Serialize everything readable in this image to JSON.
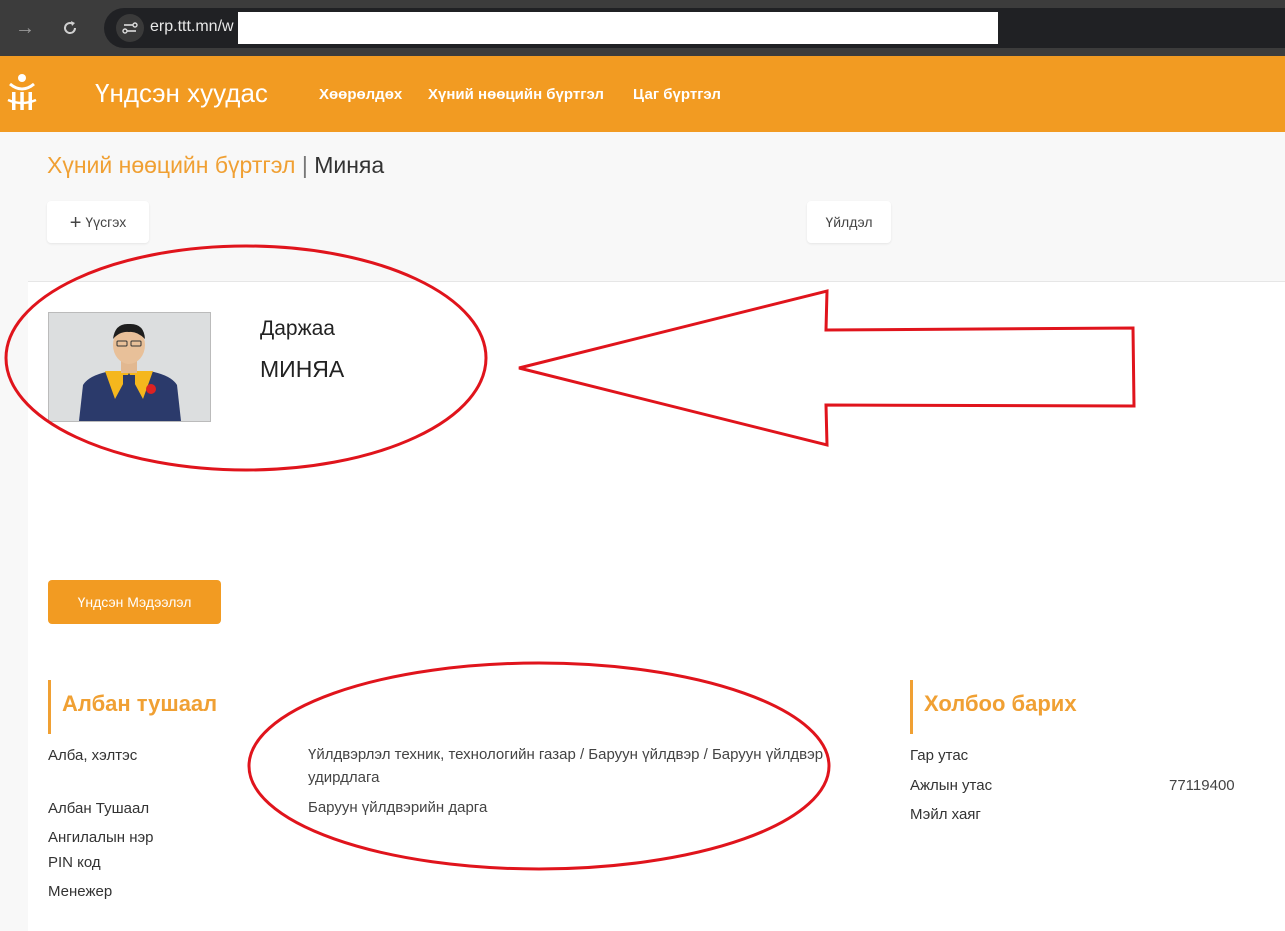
{
  "browser": {
    "url": "erp.ttt.mn/w"
  },
  "navbar": {
    "brand": "Үндсэн хуудас",
    "links": [
      "Хөөрөлдөх",
      "Хүний нөөцийн бүртгэл",
      "Цаг бүртгэл"
    ],
    "color": "#f29b22"
  },
  "page": {
    "breadcrumb_link": "Хүний нөөцийн бүртгэл",
    "separator": "|",
    "current": "Миняа",
    "create_button": "Үүсгэх",
    "action_button": "Үйлдэл"
  },
  "profile": {
    "first_name": "Даржаа",
    "last_name": "МИНЯА"
  },
  "tab": {
    "label": "Үндсэн Мэдээлэл"
  },
  "position_section": {
    "title": "Албан тушаал",
    "fields": [
      {
        "label": "Алба, хэлтэс",
        "value": "Үйлдвэрлэл техник, технологийн газар / Баруун үйлдвэр / Баруун үйлдвэр удирдлага"
      },
      {
        "label": "Албан Тушаал",
        "value": "Баруун үйлдвэрийн дарга"
      },
      {
        "label": "Ангилалын нэр",
        "value": ""
      },
      {
        "label": "PIN код",
        "value": ""
      },
      {
        "label": "Менежер",
        "value": ""
      }
    ]
  },
  "contact_section": {
    "title": "Холбоо барих",
    "fields": [
      {
        "label": "Гар утас",
        "value": ""
      },
      {
        "label": "Ажлын утас",
        "value": "77119400"
      },
      {
        "label": "Мэйл хаяг",
        "value": ""
      }
    ]
  },
  "colors": {
    "accent": "#f0a033",
    "annotation": "#e0141c"
  }
}
